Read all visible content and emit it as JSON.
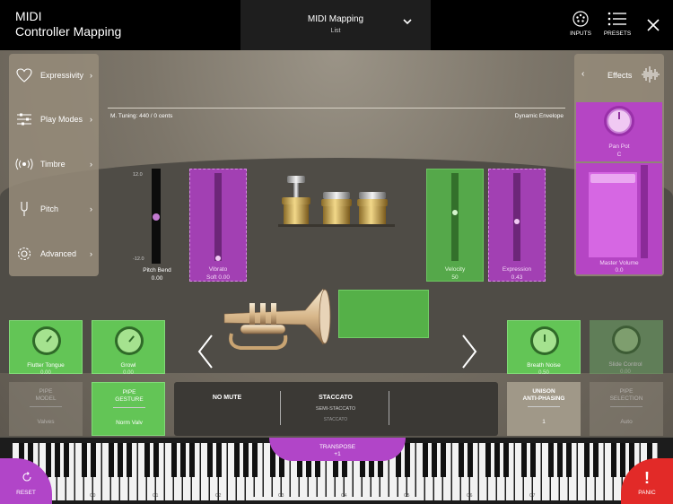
{
  "app": {
    "title_line1": "MIDI",
    "title_line2": "Controller Mapping"
  },
  "center": {
    "title": "MIDI Mapping",
    "subtitle": "List"
  },
  "topbar": {
    "inputs_label": "INPUTS",
    "presets_label": "PRESETS"
  },
  "left_panel": {
    "items": [
      {
        "label": "Expressivity",
        "icon": "heart-icon"
      },
      {
        "label": "Play Modes",
        "icon": "sliders-icon"
      },
      {
        "label": "Timbre",
        "icon": "radio-waves-icon"
      },
      {
        "label": "Pitch",
        "icon": "tuning-fork-icon"
      },
      {
        "label": "Advanced",
        "icon": "gear-icon"
      }
    ]
  },
  "effects": {
    "label": "Effects",
    "pan_pot": {
      "label": "Pan Pot",
      "value": "C"
    },
    "master_volume": {
      "label": "Master Volume",
      "value": "0.0"
    }
  },
  "tuning": {
    "text": "M. Tuning: 440   / 0 cents",
    "dynamic_envelope": "Dynamic Envelope"
  },
  "pitch_bend": {
    "label": "Pitch Bend",
    "value": "0.00",
    "max": "12.0",
    "min": "-12.0"
  },
  "vibrato": {
    "label": "Vibrato",
    "value": "Soft 0.00",
    "level": 0.0
  },
  "velocity": {
    "label": "Velocity",
    "value": "50",
    "level": 0.55,
    "max": "127"
  },
  "expression": {
    "label": "Expression",
    "value": "0.43",
    "level": 0.45
  },
  "knobs": [
    {
      "label": "Flutter Tongue",
      "value": "0.00"
    },
    {
      "label": "Growl",
      "value": "0.00"
    },
    {
      "label": "Breath Noise",
      "value": "0.50"
    },
    {
      "label": "Slide Control",
      "value": "0.00"
    }
  ],
  "lower": {
    "pipe_model": {
      "title": "PIPE\nMODEL",
      "value": "Valves"
    },
    "pipe_gesture": {
      "title": "PIPE\nGESTURE",
      "value": "Norm Valv"
    },
    "articulation": {
      "mute": "NO MUTE",
      "staccato": "STACCATO",
      "semi": "SEMI-STACCATO",
      "sub": "STACCATO"
    },
    "unison": {
      "title": "UNISON\nANTI-PHASING",
      "value": "1"
    },
    "pipe_selection": {
      "title": "PIPE\nSELECTION",
      "value": "Auto"
    }
  },
  "transpose": {
    "label": "TRANSPOSE",
    "value": "+1"
  },
  "reset_label": "RESET",
  "panic_label": "PANIC",
  "octaves": [
    "C0",
    "C1",
    "C2",
    "C3",
    "C4",
    "C5",
    "C6",
    "C7"
  ],
  "colors": {
    "purple": "#b145c8",
    "green": "#63c556",
    "panic": "#e22a28"
  }
}
